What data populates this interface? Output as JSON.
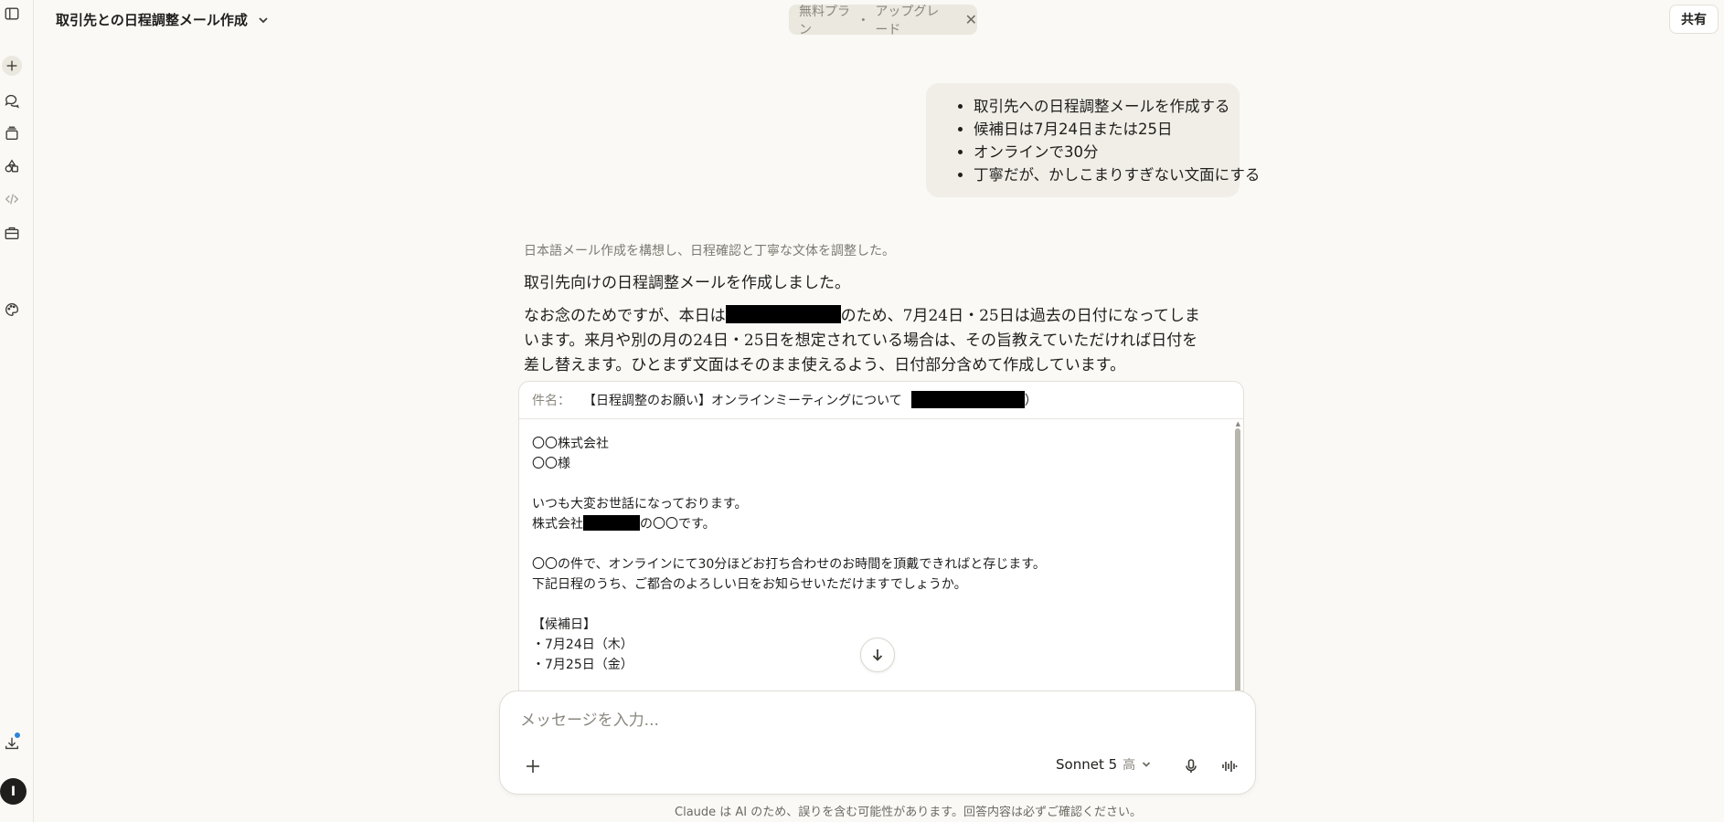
{
  "header": {
    "title": "取引先との日程調整メール作成",
    "plan_text": "無料プラン",
    "plan_sep": "・",
    "upgrade_text": "アップグレード",
    "share_label": "共有"
  },
  "sidebar": {
    "icons": [
      "sidebar-toggle-icon",
      "new-chat-icon",
      "chats-icon",
      "projects-icon",
      "artifacts-icon",
      "code-icon",
      "briefcase-icon",
      "palette-icon",
      "download-icon"
    ],
    "avatar_initial": "I"
  },
  "user_message": {
    "items": [
      "取引先への日程調整メールを作成する",
      "候補日は7月24日または25日",
      "オンラインで30分",
      "丁寧だが、かしこまりすぎない文面にする"
    ]
  },
  "assistant": {
    "thinking_summary": "日本語メール作成を構想し、日程確認と丁寧な文体を調整した。",
    "intro": "取引先向けの日程調整メールを作成しました。",
    "note_part1": "なお念のためですが、本日は",
    "note_part2": "のため、7月24日・25日は過去の日付になってしまいます。来月や別の月の24日・25日を想定されている場合は、その旨教えていただければ日付を差し替えます。ひとまず文面はそのまま使えるよう、日付部分含めて作成しています。"
  },
  "email": {
    "subject_label": "件名：",
    "subject_text": "【日程調整のお願い】オンラインミーティングについて",
    "subject_suffix": "）",
    "lines": {
      "l1": "〇〇株式会社",
      "l2": "〇〇様",
      "l3": "いつも大変お世話になっております。",
      "l4a": "株式会社",
      "l4b": "の〇〇です。",
      "l5": "〇〇の件で、オンラインにて30分ほどお打ち合わせのお時間を頂戴できればと存じます。",
      "l6": "下記日程のうち、ご都合のよろしい日をお知らせいただけますでしょうか。",
      "l7": "【候補日】",
      "l8": "・7月24日（木）",
      "l9": "・7月25日（金）"
    }
  },
  "composer": {
    "placeholder": "メッセージを入力...",
    "model": "Sonnet 5",
    "effort": "高"
  },
  "footer": {
    "disclaimer": "Claude は AI のため、誤りを含む可能性があります。回答内容は必ずご確認ください。"
  }
}
